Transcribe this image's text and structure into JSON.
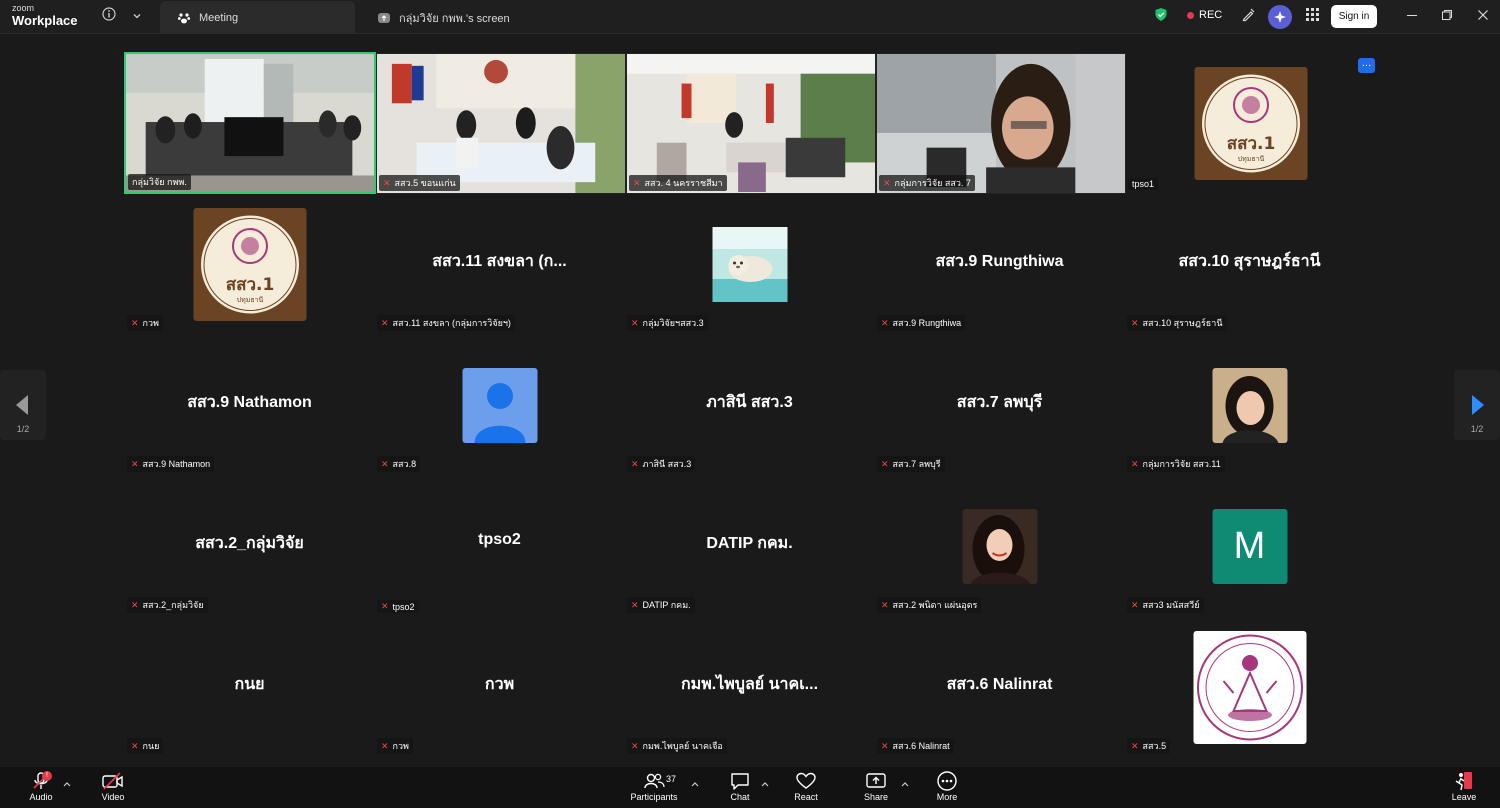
{
  "app": {
    "logo_top": "zoom",
    "logo_bottom": "Workplace"
  },
  "tabs": [
    {
      "label": "Meeting"
    },
    {
      "label": "กลุ่มวิจัย กพพ.'s screen"
    }
  ],
  "header": {
    "rec_label": "REC",
    "signin_label": "Sign in"
  },
  "tiles": [
    {
      "id": "t1",
      "type": "video",
      "name": "กลุ่มวิจัย กพพ.",
      "speaking": true
    },
    {
      "id": "t2",
      "type": "video",
      "name": "สสว.5 ขอนแก่น"
    },
    {
      "id": "t3",
      "type": "video",
      "name": "สสว. 4 นครราชสีมา"
    },
    {
      "id": "t4",
      "type": "video",
      "name": "กลุ่มการวิจัย สสว. 7"
    },
    {
      "id": "t5",
      "type": "avatar",
      "name": "tpso1"
    },
    {
      "id": "t6",
      "type": "avatar",
      "name": "กวพ"
    },
    {
      "id": "t7",
      "type": "text",
      "display": "สสว.11 สงขลา (ก...",
      "name": "สสว.11 สงขลา (กลุ่มการวิจัยฯ)"
    },
    {
      "id": "t8",
      "type": "avatar",
      "name": "กลุ่มวิจัยฯสสว.3"
    },
    {
      "id": "t9",
      "type": "text",
      "display": "สสว.9 Rungthiwa",
      "name": "สสว.9 Rungthiwa"
    },
    {
      "id": "t10",
      "type": "text",
      "display": "สสว.10 สุราษฎร์ธานี",
      "name": "สสว.10 สุราษฎร์ธานี"
    },
    {
      "id": "t11",
      "type": "text",
      "display": "สสว.9 Nathamon",
      "name": "สสว.9 Nathamon"
    },
    {
      "id": "t12",
      "type": "avatar",
      "name": "สสว.8"
    },
    {
      "id": "t13",
      "type": "text",
      "display": "ภาสินี สสว.3",
      "name": "ภาสินี สสว.3"
    },
    {
      "id": "t14",
      "type": "text",
      "display": "สสว.7 ลพบุรี",
      "name": "สสว.7 ลพบุรี"
    },
    {
      "id": "t15",
      "type": "avatar",
      "name": "กลุ่มการวิจัย สสว.11"
    },
    {
      "id": "t16",
      "type": "text",
      "display": "สสว.2_กลุ่มวิจัย",
      "name": "สสว.2_กลุ่มวิจัย"
    },
    {
      "id": "t17",
      "type": "text",
      "display": "tpso2",
      "name": "tpso2"
    },
    {
      "id": "t18",
      "type": "text",
      "display": "DATIP กคม.",
      "name": "DATIP กคม."
    },
    {
      "id": "t19",
      "type": "avatar",
      "name": "สสว.2 พนิดา แผ่นอุดร"
    },
    {
      "id": "t20",
      "type": "avatar",
      "avatar_letter": "M",
      "name": "สสว3 มนัสสวีย์"
    },
    {
      "id": "t21",
      "type": "text",
      "display": "กนย",
      "name": "กนย"
    },
    {
      "id": "t22",
      "type": "text",
      "display": "กวพ",
      "name": "กวพ"
    },
    {
      "id": "t23",
      "type": "text",
      "display": "กมพ.ไพบูลย์ นาคเ...",
      "name": "กมพ.ไพบูลย์ นาคเจือ"
    },
    {
      "id": "t24",
      "type": "text",
      "display": "สสว.6 Nalinrat",
      "name": "สสว.6 Nalinrat"
    },
    {
      "id": "t25",
      "type": "avatar",
      "name": "สสว.5"
    }
  ],
  "logo_text": {
    "main": "สสว.1",
    "sub": "ปทุมธานี"
  },
  "pager": {
    "label": "1/2"
  },
  "toolbar": {
    "audio": "Audio",
    "audio_badge": "!",
    "video": "Video",
    "participants": "Participants",
    "participants_count": "37",
    "chat": "Chat",
    "react": "React",
    "share": "Share",
    "more": "More",
    "leave": "Leave"
  },
  "colors": {
    "speaking": "#2ecc71",
    "mute": "#e84a4a",
    "leave": "#e8394c",
    "accent": "#1e6fe6",
    "avatar_m": "#0f8a73",
    "avatar_person": "#6d9eeb"
  }
}
